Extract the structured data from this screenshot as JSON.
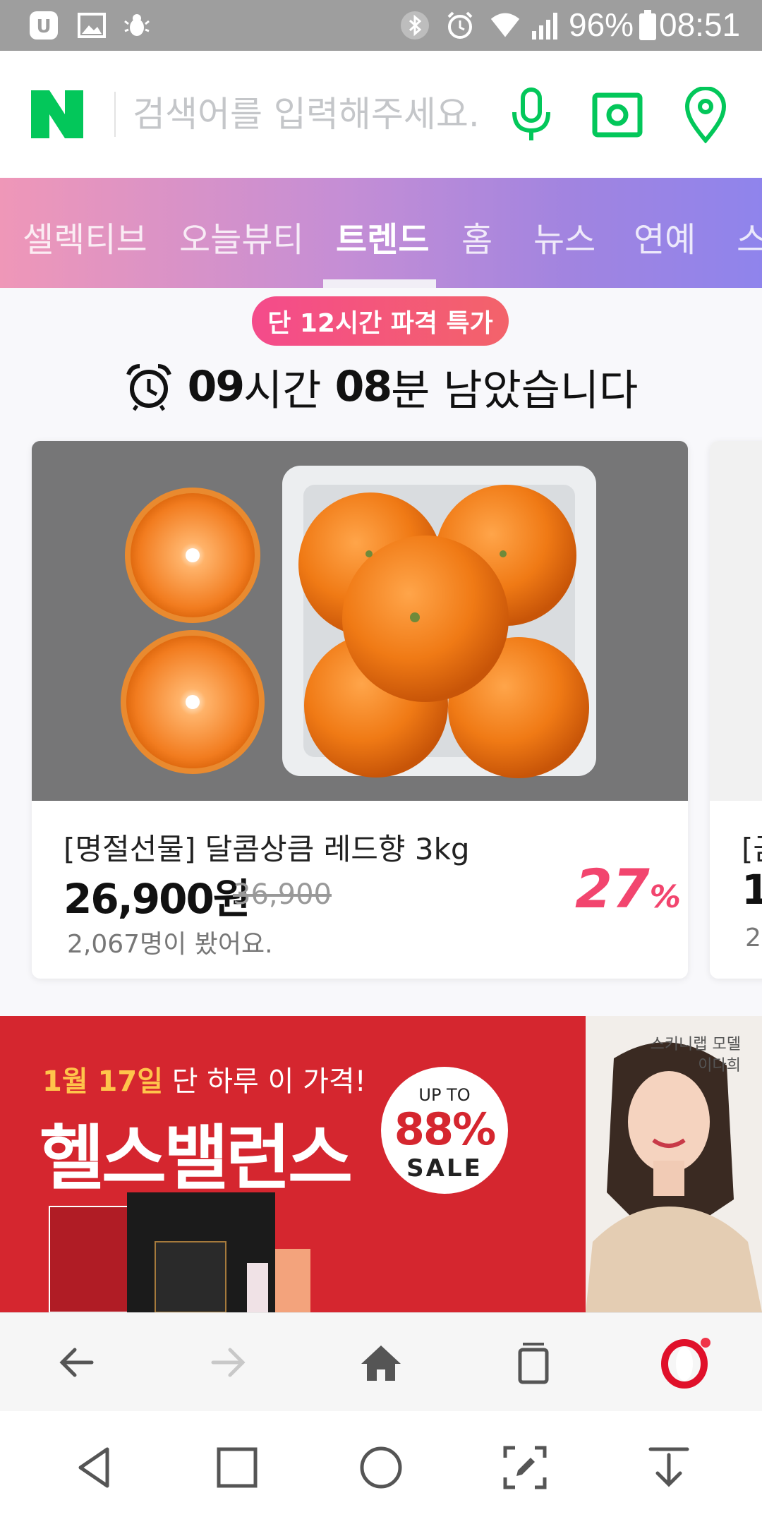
{
  "status_bar": {
    "battery": "96%",
    "time": "08:51",
    "icons": [
      "opera-icon",
      "image-icon",
      "bug-icon",
      "bluetooth-icon",
      "alarm-icon",
      "wifi-icon",
      "signal-icon",
      "battery-icon"
    ]
  },
  "header": {
    "logo_text": "N",
    "search_placeholder": "검색어를 입력해주세요.",
    "icons": [
      "microphone-icon",
      "camera-lens-icon",
      "location-pin-icon"
    ],
    "brand_color": "#03c75a"
  },
  "tabs": {
    "items": [
      "셀렉티브",
      "오늘뷰티",
      "트렌드",
      "홈",
      "뉴스",
      "연예",
      "스"
    ],
    "active": "트렌드"
  },
  "deal": {
    "badge": "단 12시간 파격 특가",
    "hours": "09",
    "hours_unit": "시간 ",
    "minutes": "08",
    "minutes_unit": "분 남았습니다"
  },
  "products": [
    {
      "title": "[명절선물] 달콤상큼 레드향 3kg",
      "price": "26,900원",
      "original_price": "36,900",
      "views": "2,067명이 봤어요.",
      "discount": "27",
      "discount_unit": "%"
    },
    {
      "title_partial": "[금",
      "price_partial": "1",
      "views_partial": "2,"
    }
  ],
  "banner": {
    "date": "1월 17일",
    "date_suffix": " 단 하루 이 가격!",
    "title": "헬스밸런스",
    "up_to": "UP TO",
    "percent": "88%",
    "sale": "SALE",
    "model_label": "스키니랩 모델",
    "model_name": "이다희"
  },
  "browser_bar": {
    "buttons": [
      "back-arrow-icon",
      "forward-arrow-icon",
      "home-icon",
      "tabs-icon",
      "opera-menu-icon"
    ]
  },
  "nav_bar": {
    "buttons": [
      "back-triangle-icon",
      "recents-square-icon",
      "home-circle-icon",
      "screenshot-edit-icon",
      "download-arrow-icon"
    ]
  }
}
